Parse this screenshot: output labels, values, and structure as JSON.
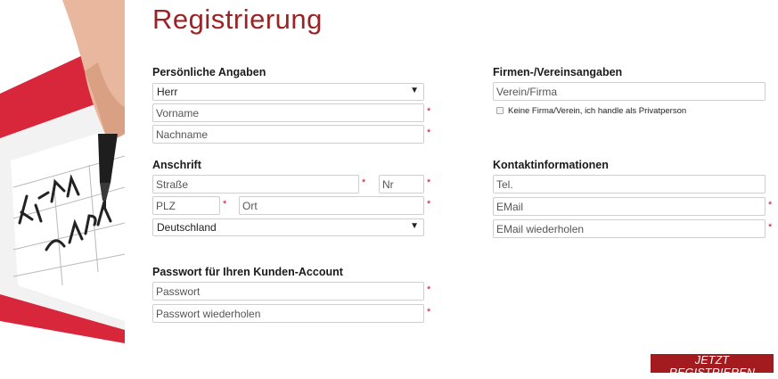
{
  "page": {
    "title": "Registrierung"
  },
  "personal": {
    "heading": "Persönliche Angaben",
    "salutation_value": "Herr",
    "firstname_placeholder": "Vorname",
    "lastname_placeholder": "Nachname"
  },
  "company": {
    "heading": "Firmen-/Vereinsangaben",
    "company_placeholder": "Verein/Firma",
    "private_checkbox_label": "Keine Firma/Verein, ich handle als Privatperson"
  },
  "address": {
    "heading": "Anschrift",
    "street_placeholder": "Straße",
    "number_placeholder": "Nr",
    "zip_placeholder": "PLZ",
    "city_placeholder": "Ort",
    "country_value": "Deutschland"
  },
  "contact": {
    "heading": "Kontaktinformationen",
    "phone_placeholder": "Tel.",
    "email_placeholder": "EMail",
    "email_repeat_placeholder": "EMail wiederholen"
  },
  "password": {
    "heading": "Passwort für Ihren Kunden-Account",
    "password_placeholder": "Passwort",
    "password_repeat_placeholder": "Passwort wiederholen"
  },
  "actions": {
    "submit_label": "JETZT REGISTRIEREN"
  },
  "misc": {
    "required_marker": "*",
    "dropdown_arrow": "▼"
  },
  "colors": {
    "accent": "#9a2326",
    "required": "#c8102e",
    "button": "#a31b1e"
  }
}
